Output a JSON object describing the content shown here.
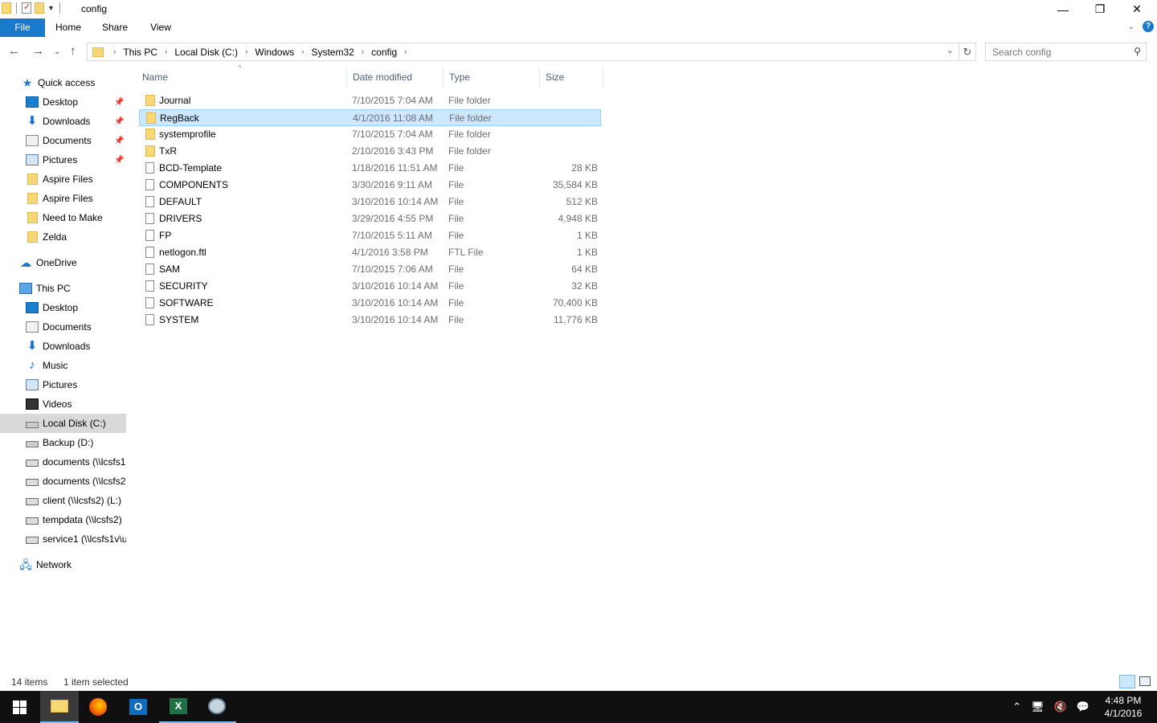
{
  "window": {
    "title": "config",
    "controls": {
      "minimize": "—",
      "restore": "❐",
      "close": "✕"
    }
  },
  "ribbon": {
    "tabs": [
      "File",
      "Home",
      "Share",
      "View"
    ]
  },
  "address": {
    "crumbs": [
      "This PC",
      "Local Disk (C:)",
      "Windows",
      "System32",
      "config"
    ],
    "search_placeholder": "Search config"
  },
  "sidebar": {
    "quick_access": "Quick access",
    "quick_items": [
      "Desktop",
      "Downloads",
      "Documents",
      "Pictures",
      "Aspire Files",
      "Aspire Files",
      "Need to Make",
      "Zelda"
    ],
    "onedrive": "OneDrive",
    "this_pc": "This PC",
    "pc_items": [
      "Desktop",
      "Documents",
      "Downloads",
      "Music",
      "Pictures",
      "Videos",
      "Local Disk (C:)",
      "Backup (D:)",
      "documents (\\\\lcsfs1",
      "documents (\\\\lcsfs2",
      "client (\\\\lcsfs2) (L:)",
      "tempdata (\\\\lcsfs2)",
      "service1 (\\\\lcsfs1v\\u"
    ],
    "network": "Network",
    "selected": "Local Disk (C:)"
  },
  "columns": [
    "Name",
    "Date modified",
    "Type",
    "Size"
  ],
  "files": [
    {
      "name": "Journal",
      "date": "7/10/2015 7:04 AM",
      "type": "File folder",
      "size": "",
      "kind": "folder"
    },
    {
      "name": "RegBack",
      "date": "4/1/2016 11:08 AM",
      "type": "File folder",
      "size": "",
      "kind": "folder",
      "selected": true
    },
    {
      "name": "systemprofile",
      "date": "7/10/2015 7:04 AM",
      "type": "File folder",
      "size": "",
      "kind": "folder"
    },
    {
      "name": "TxR",
      "date": "2/10/2016 3:43 PM",
      "type": "File folder",
      "size": "",
      "kind": "folder"
    },
    {
      "name": "BCD-Template",
      "date": "1/18/2016 11:51 AM",
      "type": "File",
      "size": "28 KB",
      "kind": "file"
    },
    {
      "name": "COMPONENTS",
      "date": "3/30/2016 9:11 AM",
      "type": "File",
      "size": "35,584 KB",
      "kind": "file"
    },
    {
      "name": "DEFAULT",
      "date": "3/10/2016 10:14 AM",
      "type": "File",
      "size": "512 KB",
      "kind": "file"
    },
    {
      "name": "DRIVERS",
      "date": "3/29/2016 4:55 PM",
      "type": "File",
      "size": "4,948 KB",
      "kind": "file"
    },
    {
      "name": "FP",
      "date": "7/10/2015 5:11 AM",
      "type": "File",
      "size": "1 KB",
      "kind": "file"
    },
    {
      "name": "netlogon.ftl",
      "date": "4/1/2016 3:58 PM",
      "type": "FTL File",
      "size": "1 KB",
      "kind": "file"
    },
    {
      "name": "SAM",
      "date": "7/10/2015 7:06 AM",
      "type": "File",
      "size": "64 KB",
      "kind": "file"
    },
    {
      "name": "SECURITY",
      "date": "3/10/2016 10:14 AM",
      "type": "File",
      "size": "32 KB",
      "kind": "file"
    },
    {
      "name": "SOFTWARE",
      "date": "3/10/2016 10:14 AM",
      "type": "File",
      "size": "70,400 KB",
      "kind": "file"
    },
    {
      "name": "SYSTEM",
      "date": "3/10/2016 10:14 AM",
      "type": "File",
      "size": "11,776 KB",
      "kind": "file"
    }
  ],
  "status": {
    "count": "14 items",
    "selection": "1 item selected"
  },
  "taskbar": {
    "apps": [
      "start-icon",
      "file-explorer-icon",
      "firefox-icon",
      "outlook-icon",
      "excel-icon",
      "paint-icon"
    ],
    "outlook_letter": "O",
    "excel_letter": "X",
    "time": "4:48 PM",
    "date": "4/1/2016"
  },
  "colors": {
    "accent": "#1979ca",
    "selection": "#cce8ff",
    "taskbar": "#101010"
  }
}
